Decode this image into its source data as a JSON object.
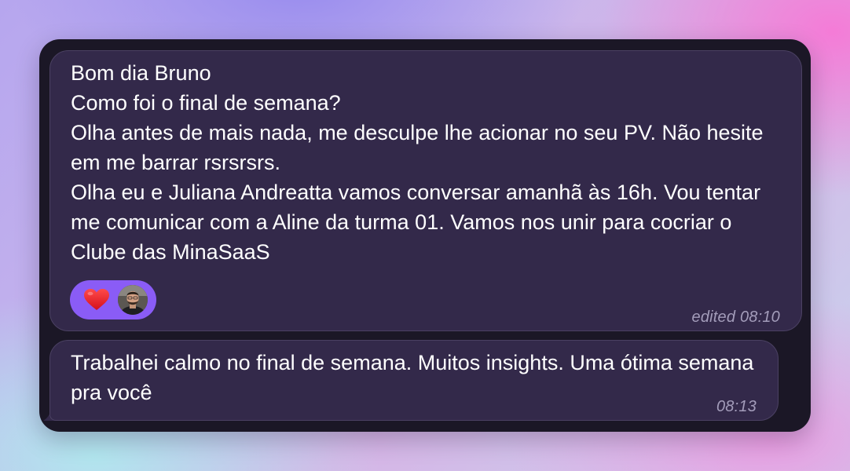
{
  "messages": [
    {
      "lines": [
        "Bom dia Bruno",
        "Como foi o final de semana?",
        "Olha antes de mais nada, me desculpe lhe acionar no seu PV. Não hesite em me barrar rsrsrsrs.",
        "Olha eu e Juliana Andreatta vamos conversar amanhã às 16h. Vou tentar me comunicar com a Aline da turma 01. Vamos nos unir para cocriar o Clube das MinaSaaS"
      ],
      "meta": "edited 08:10",
      "reaction": {
        "emoji_icon": "red-heart-icon",
        "reactor": "avatar"
      }
    },
    {
      "lines": [
        "Trabalhei calmo no final de semana. Muitos insights. Uma ótima semana pra você"
      ],
      "meta": "08:13"
    }
  ],
  "colors": {
    "bubble": "#33294a",
    "panel": "#1b1726",
    "reaction_pill": "#8a5cf6",
    "meta_text": "#a39cba"
  }
}
